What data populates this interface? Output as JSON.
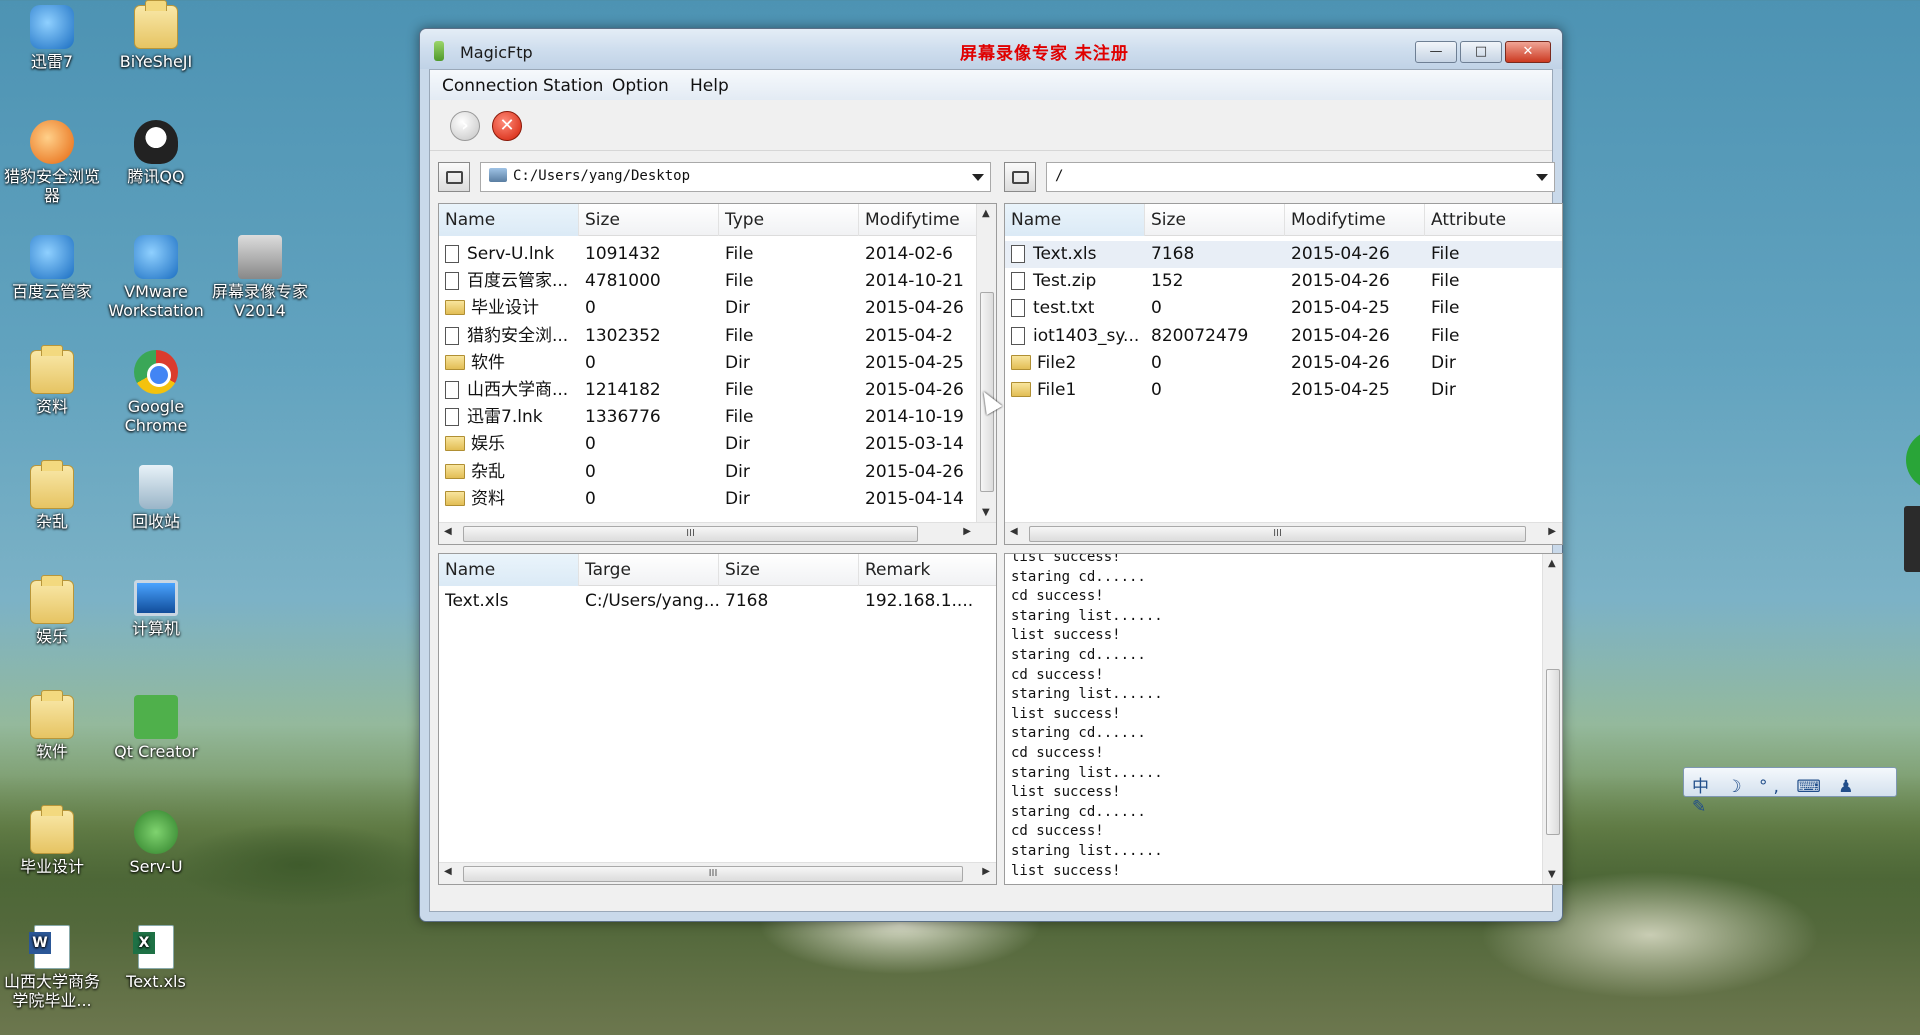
{
  "desktop": {
    "icons": [
      {
        "label": "迅雷7",
        "kind": "app"
      },
      {
        "label": "BiYeSheJI",
        "kind": "folder"
      },
      {
        "label": "猎豹安全浏览器",
        "kind": "orange"
      },
      {
        "label": "腾讯QQ",
        "kind": "qq"
      },
      {
        "label": "百度云管家",
        "kind": "app"
      },
      {
        "label": "VMware Workstation",
        "kind": "app"
      },
      {
        "label": "屏幕录像专家V2014",
        "kind": "rec"
      },
      {
        "label": "资料",
        "kind": "folder"
      },
      {
        "label": "Google Chrome",
        "kind": "chrome"
      },
      {
        "label": "杂乱",
        "kind": "folder"
      },
      {
        "label": "回收站",
        "kind": "bin"
      },
      {
        "label": "娱乐",
        "kind": "folder"
      },
      {
        "label": "计算机",
        "kind": "pc"
      },
      {
        "label": "软件",
        "kind": "folder"
      },
      {
        "label": "Qt Creator",
        "kind": "qt"
      },
      {
        "label": "毕业设计",
        "kind": "folder"
      },
      {
        "label": "Serv-U",
        "kind": "serv"
      },
      {
        "label": "山西大学商务学院毕业...",
        "kind": "doc"
      },
      {
        "label": "Text.xls",
        "kind": "xls"
      }
    ],
    "ime_bar": "中 ☽ °, ⌨ ♟ ✎"
  },
  "window": {
    "title": "MagicFtp",
    "watermark": "屏幕录像专家  未注册",
    "buttons": {
      "minimize": "—",
      "maximize": "□",
      "close": "✕"
    }
  },
  "menu": [
    "Connection",
    "Station",
    "Option",
    "Help"
  ],
  "toolbar": {
    "connect_icon": "›",
    "disconnect_icon": "✕"
  },
  "local": {
    "path": "C:/Users/yang/Desktop",
    "columns": [
      "Name",
      "Size",
      "Type",
      "Modifytime"
    ],
    "rows": [
      {
        "name": "Serv-U.lnk",
        "size": "1091432",
        "type": "File",
        "time": "2014-02-6",
        "is_dir": false
      },
      {
        "name": "百度云管家...",
        "size": "4781000",
        "type": "File",
        "time": "2014-10-21",
        "is_dir": false
      },
      {
        "name": "毕业设计",
        "size": "0",
        "type": "Dir",
        "time": "2015-04-26",
        "is_dir": true
      },
      {
        "name": "猎豹安全浏...",
        "size": "1302352",
        "type": "File",
        "time": "2015-04-2",
        "is_dir": false
      },
      {
        "name": "软件",
        "size": "0",
        "type": "Dir",
        "time": "2015-04-25",
        "is_dir": true
      },
      {
        "name": "山西大学商...",
        "size": "1214182",
        "type": "File",
        "time": "2015-04-26",
        "is_dir": false
      },
      {
        "name": "迅雷7.lnk",
        "size": "1336776",
        "type": "File",
        "time": "2014-10-19",
        "is_dir": false
      },
      {
        "name": "娱乐",
        "size": "0",
        "type": "Dir",
        "time": "2015-03-14",
        "is_dir": true
      },
      {
        "name": "杂乱",
        "size": "0",
        "type": "Dir",
        "time": "2015-04-26",
        "is_dir": true
      },
      {
        "name": "资料",
        "size": "0",
        "type": "Dir",
        "time": "2015-04-14",
        "is_dir": true
      }
    ]
  },
  "remote": {
    "path": "/",
    "columns": [
      "Name",
      "Size",
      "Modifytime",
      "Attribute"
    ],
    "rows": [
      {
        "name": "Text.xls",
        "size": "7168",
        "time": "2015-04-26",
        "attr": "File",
        "is_dir": false
      },
      {
        "name": "Test.zip",
        "size": "152",
        "time": "2015-04-26",
        "attr": "File",
        "is_dir": false
      },
      {
        "name": "test.txt",
        "size": "0",
        "time": "2015-04-25",
        "attr": "File",
        "is_dir": false
      },
      {
        "name": "iot1403_sy...",
        "size": "820072479",
        "time": "2015-04-26",
        "attr": "File",
        "is_dir": false
      },
      {
        "name": "File2",
        "size": "0",
        "time": "2015-04-26",
        "attr": "Dir",
        "is_dir": true
      },
      {
        "name": "File1",
        "size": "0",
        "time": "2015-04-25",
        "attr": "Dir",
        "is_dir": true
      }
    ]
  },
  "queue": {
    "columns": [
      "Name",
      "Targe",
      "Size",
      "Remark"
    ],
    "rows": [
      {
        "name": "Text.xls",
        "target": "C:/Users/yang...",
        "size": "7168",
        "remark": "192.168.1...."
      }
    ]
  },
  "log": {
    "lines": [
      "list success!",
      "staring cd......",
      "cd success!",
      "staring list......",
      "list success!",
      "staring cd......",
      "cd success!",
      "staring list......",
      "list success!",
      "staring cd......",
      "cd success!",
      "staring list......",
      "list success!",
      "staring cd......",
      "cd success!",
      "staring list......",
      "list success!"
    ]
  },
  "scroll_glyphs": {
    "up": "▲",
    "down": "▼",
    "left": "◀",
    "right": "▶",
    "grip": "III"
  }
}
